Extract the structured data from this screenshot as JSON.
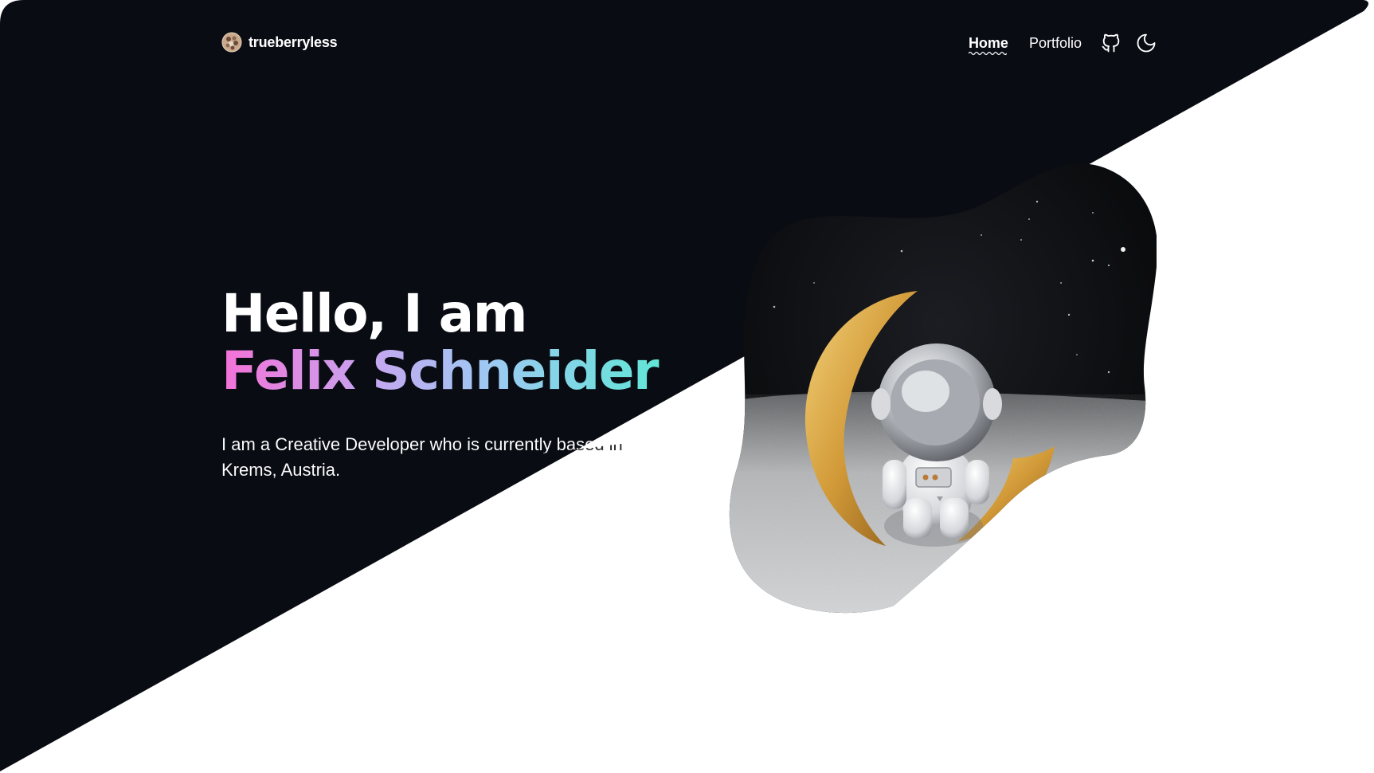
{
  "site": {
    "brand_name": "trueberryless",
    "logo_icon": "berry-logo-icon"
  },
  "nav": {
    "items": [
      {
        "label": "Home",
        "active": true
      },
      {
        "label": "Portfolio",
        "active": false
      }
    ],
    "github_icon": "github-icon",
    "theme_toggle_icon": "moon-icon"
  },
  "hero": {
    "greeting": "Hello, I am",
    "name": "Felix Schneider",
    "description": "I am a Creative Developer who is currently based in Krems, Austria.",
    "image_subject": "astronaut figurine sitting on a golden crescent moon"
  },
  "colors": {
    "dark_bg": "#090c13",
    "light_bg": "#ffffff",
    "gradient_start": "#f472d8",
    "gradient_mid": "#9ec9f2",
    "gradient_end": "#5ee7d6",
    "moon_gold": "#d9a441"
  }
}
